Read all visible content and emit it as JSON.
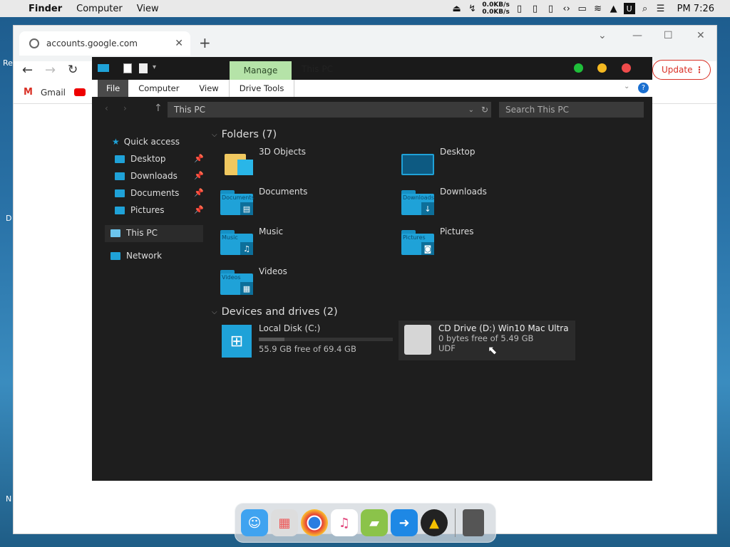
{
  "menubar": {
    "apple": "",
    "app": "Finder",
    "items": [
      "Computer",
      "View"
    ],
    "net_up": "0.0KB/s",
    "net_down": "0.0KB/s",
    "time": "PM 7:26"
  },
  "chrome": {
    "tab_title": "accounts.google.com",
    "bookmarks": [
      "Gmail"
    ],
    "update_label": "Update"
  },
  "explorer": {
    "manage_label": "Manage",
    "title": "This PC",
    "ribbon": [
      "File",
      "Computer",
      "View",
      "Drive Tools"
    ],
    "address": "This PC",
    "search_placeholder": "Search This PC",
    "nav": {
      "quick_access": "Quick access",
      "pinned": [
        "Desktop",
        "Downloads",
        "Documents",
        "Pictures"
      ],
      "this_pc": "This PC",
      "network": "Network"
    },
    "folders_header": "Folders (7)",
    "folders": [
      "3D Objects",
      "Desktop",
      "Documents",
      "Downloads",
      "Music",
      "Pictures",
      "Videos"
    ],
    "folder_overlays": [
      "Documents",
      "Downloads",
      "Music",
      "Pictures",
      "Videos"
    ],
    "devices_header": "Devices and drives (2)",
    "drives": [
      {
        "name": "Local Disk (C:)",
        "free": "55.9 GB free of 69.4 GB",
        "used_fraction": 0.19
      },
      {
        "name": "CD Drive (D:) Win10 Mac Ultra",
        "free": "0 bytes free of 5.49 GB",
        "fs": "UDF"
      }
    ]
  },
  "colors": {
    "accent": "#1fa2d8",
    "manage": "#b5e3a8",
    "close": "#ef4b4b",
    "min": "#f5b921",
    "max": "#1fbf3a"
  }
}
